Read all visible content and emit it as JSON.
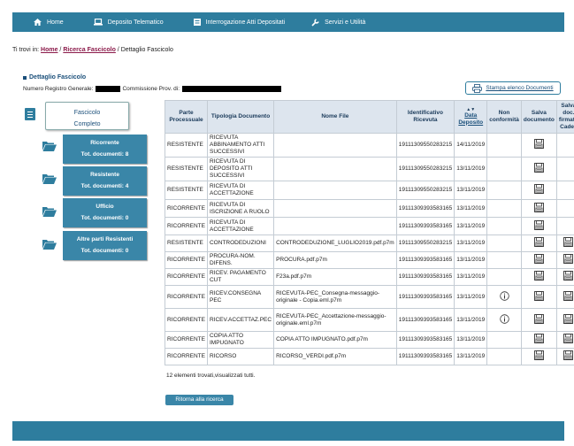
{
  "nav": {
    "home": "Home",
    "deposito": "Deposito Telematico",
    "interrogazione": "Interrogazione Atti Depositati",
    "servizi": "Servizi e Utilità"
  },
  "breadcrumb": {
    "prefix": "Ti trovi in: ",
    "home": "Home",
    "sep1": " / ",
    "ricerca": "Ricerca Fascicolo",
    "sep2": " / ",
    "current": "Dettaglio Fascicolo"
  },
  "detail": {
    "title": "Dettaglio Fascicolo",
    "reg_label": "Numero Registro Generale:",
    "comm_label": "Commissione Prov. di:",
    "print_label": "Stampa elenco Documenti"
  },
  "left": {
    "fascicolo_line1": "Fascicolo",
    "fascicolo_line2": "Completo",
    "categories": [
      {
        "name": "Ricorrente",
        "count": "Tot. documenti: 8"
      },
      {
        "name": "Resistente",
        "count": "Tot. documenti: 4"
      },
      {
        "name": "Ufficio",
        "count": "Tot. documenti: 0"
      },
      {
        "name": "Altre parti Resistenti",
        "count": "Tot. documenti: 0"
      }
    ]
  },
  "table": {
    "headers": [
      "Parte Processuale",
      "Tipologia Documento",
      "Nome File",
      "Identificativo Ricevuta",
      "Data Deposito",
      "Non conformità",
      "Salva documento",
      "Salva doc. firmato Cades"
    ],
    "rows": [
      {
        "parte": "RESISTENTE",
        "tipo": "RICEVUTA ABBINAMENTO ATTI SUCCESSIVI",
        "file": "",
        "id": "19111309550283215",
        "data": "14/11/2019",
        "nc": false,
        "cades": false
      },
      {
        "parte": "RESISTENTE",
        "tipo": "RICEVUTA DI DEPOSITO ATTI SUCCESSIVI",
        "file": "",
        "id": "19111309550283215",
        "data": "13/11/2019",
        "nc": false,
        "cades": false
      },
      {
        "parte": "RESISTENTE",
        "tipo": "RICEVUTA DI ACCETTAZIONE",
        "file": "",
        "id": "19111309550283215",
        "data": "13/11/2019",
        "nc": false,
        "cades": false
      },
      {
        "parte": "RICORRENTE",
        "tipo": "RICEVUTA DI ISCRIZIONE A RUOLO",
        "file": "",
        "id": "19111309393583165",
        "data": "13/11/2019",
        "nc": false,
        "cades": false
      },
      {
        "parte": "RICORRENTE",
        "tipo": "RICEVUTA DI ACCETTAZIONE",
        "file": "",
        "id": "19111309393583165",
        "data": "13/11/2019",
        "nc": false,
        "cades": false
      },
      {
        "parte": "RESISTENTE",
        "tipo": "CONTRODEDUZIONI",
        "file": "CONTRODEDUZIONE_LUGLIO2019.pdf.p7m",
        "id": "19111309550283215",
        "data": "13/11/2019",
        "nc": false,
        "cades": true
      },
      {
        "parte": "RICORRENTE",
        "tipo": "PROCURA-NOM. DIFENS.",
        "file": "PROCURA.pdf.p7m",
        "id": "19111309393583165",
        "data": "13/11/2019",
        "nc": false,
        "cades": true
      },
      {
        "parte": "RICORRENTE",
        "tipo": "RICEV. PAGAMENTO CUT",
        "file": "F23a.pdf.p7m",
        "id": "19111309393583165",
        "data": "13/11/2019",
        "nc": false,
        "cades": true
      },
      {
        "parte": "RICORRENTE",
        "tipo": "RICEV.CONSEGNA PEC",
        "file": "RICEVUTA-PEC_Consegna-messaggio-originale - Copia.eml.p7m",
        "id": "19111309393583165",
        "data": "13/11/2019",
        "nc": true,
        "cades": true
      },
      {
        "parte": "RICORRENTE",
        "tipo": "RICEV.ACCETTAZ.PEC",
        "file": "RICEVUTA-PEC_Accettazione-messaggio-originale.eml.p7m",
        "id": "19111309393583165",
        "data": "13/11/2019",
        "nc": true,
        "cades": true
      },
      {
        "parte": "RICORRENTE",
        "tipo": "COPIA ATTO IMPUGNATO",
        "file": "COPIA ATTO IMPUGNATO.pdf.p7m",
        "id": "19111309393583165",
        "data": "13/11/2019",
        "nc": false,
        "cades": true
      },
      {
        "parte": "RICORRENTE",
        "tipo": "RICORSO",
        "file": "RICORSO_VERDI.pdf.p7m",
        "id": "19111309393583165",
        "data": "13/11/2019",
        "nc": false,
        "cades": true
      }
    ],
    "footer": "12 elementi trovati,visualizzati tutti."
  },
  "actions": {
    "back": "Ritorna alla ricerca"
  },
  "colors": {
    "nav_bg": "#2e7d9e",
    "category_bg": "#3a86a8",
    "header_bg": "#dde5ee",
    "link": "#8b1a4a"
  }
}
